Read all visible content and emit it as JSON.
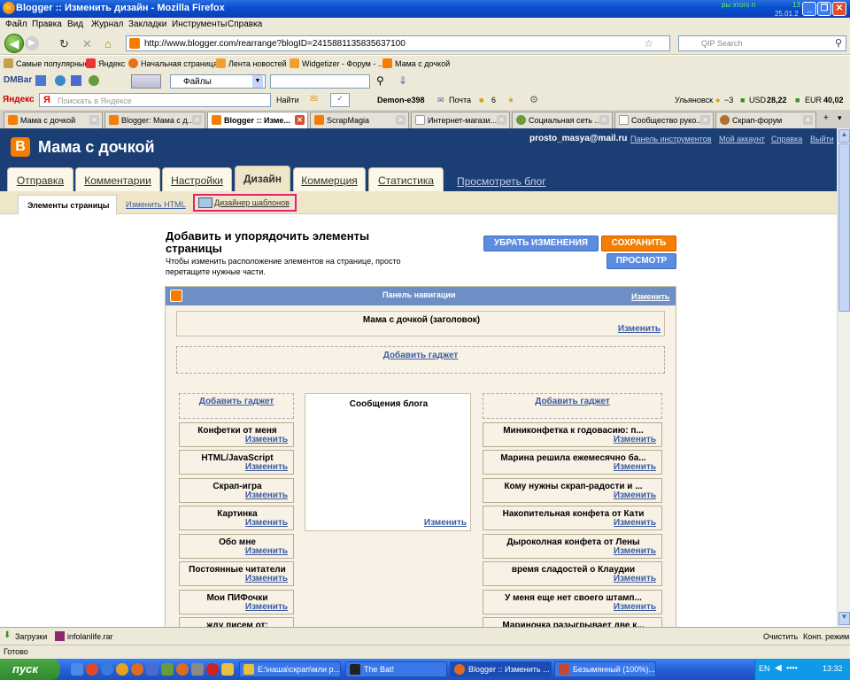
{
  "window": {
    "title": "Blogger :: Изменить дизайн - Mozilla Firefox",
    "clock_top": "13",
    "clock_date": "25.01.2",
    "clock_green": "ры этого п"
  },
  "menu": [
    "Файл",
    "Правка",
    "Вид",
    "Журнал",
    "Закладки",
    "Инструменты",
    "Справка"
  ],
  "nav": {
    "url": "http://www.blogger.com/rearrange?blogID=2415881135835637100",
    "search_placeholder": "QIP Search"
  },
  "bookmarks": [
    "Самые популярные",
    "Яндекс",
    "Начальная страница",
    "Лента новостей",
    "Widgetizer - Форум - ...",
    "Мама с дочкой"
  ],
  "dmbar": {
    "label": "DMBar",
    "files": "Файлы"
  },
  "yabar": {
    "logo": "Яндекс",
    "search_placeholder": "Поискать в Яндексе",
    "find": "Найти",
    "user": "Demon-e398",
    "mail": "Почта",
    "count": "6",
    "city": "Ульяновск",
    "temp": "−3",
    "usd": "USD",
    "usd_val": "28,22",
    "eur": "EUR",
    "eur_val": "40,02"
  },
  "tabs": [
    "Мама с дочкой",
    "Blogger: Мама с д...",
    "Blogger :: Изме...",
    "ScrapMagia",
    "Интернет-магази...",
    "Социальная сеть ...",
    "Сообщество руко...",
    "Скрап-форум"
  ],
  "blogger": {
    "blog_name": "Мама с дочкой",
    "user_email": "prosto_masya@mail.ru",
    "links": [
      "Панель инструментов",
      "Мой аккаунт",
      "Справка",
      "Выйти"
    ],
    "main_tabs": [
      "Отправка",
      "Комментарии",
      "Настройки",
      "Дизайн",
      "Коммерция",
      "Статистика"
    ],
    "view_blog": "Просмотреть блог",
    "sub_tabs": [
      "Элементы страницы",
      "Изменить HTML",
      "Дизайнер шаблонов"
    ]
  },
  "content": {
    "title": "Добавить и упорядочить элементы страницы",
    "desc": "Чтобы изменить расположение элементов на странице, просто перетащите нужные части.",
    "btn_cancel": "УБРАТЬ ИЗМЕНЕНИЯ",
    "btn_save": "СОХРАНИТЬ",
    "btn_preview": "ПРОСМОТР",
    "navbar_title": "Панель навигации",
    "edit": "Изменить",
    "add_gadget": "Добавить гаджет",
    "header_title": "Мама с дочкой (заголовок)",
    "blog_posts": "Сообщения блога",
    "left_gadgets": [
      "Конфетки от меня",
      "HTML/JavaScript",
      "Скрап-игра",
      "Картинка",
      "Обо мне",
      "Постоянные читатели",
      "Мои ПИФочки",
      "жду писем от:"
    ],
    "right_gadgets": [
      "Миниконфетка к годовасию: п...",
      "Марина решила ежемесячно ба...",
      "Кому нужны скрап-радости и ...",
      "Накопительная конфета от Кати",
      "Дыроколная конфета от Лены",
      "время сладостей о Клаудии",
      "У меня еще нет своего штамп...",
      "Мариночка разыгрывает две к..."
    ]
  },
  "status": {
    "downloads": "Загрузки",
    "file": "infolanlife.rar",
    "clear": "Очистить",
    "mode": "Конп. режим",
    "done": "Готово"
  },
  "taskbar": {
    "start": "пуск",
    "tasks": [
      "E:\\наша\\скрап\\мли р...",
      "The Bat!",
      "Blogger :: Изменить ...",
      "Безымянный (100%)..."
    ],
    "lang": "EN",
    "time": "13:32"
  }
}
